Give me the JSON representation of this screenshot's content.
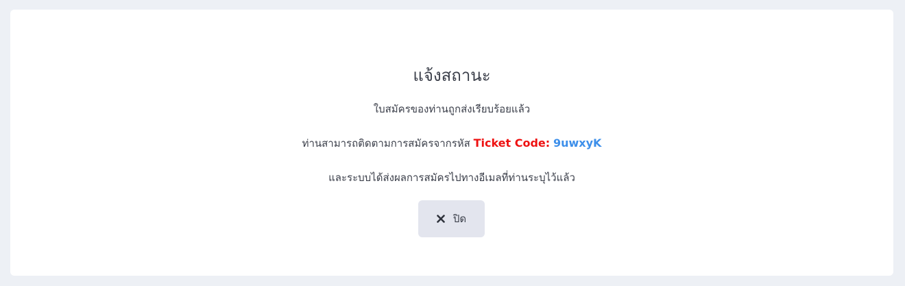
{
  "dialog": {
    "title": "แจ้งสถานะ",
    "message_submitted": "ใบสมัครของท่านถูกส่งเรียบร้อยแล้ว",
    "message_track_prefix": "ท่านสามารถติดตามการสมัครจากรหัส",
    "ticket_label": "Ticket Code:",
    "ticket_code": "9uwxyK",
    "message_email": "และระบบได้ส่งผลการสมัครไปทางอีเมลที่ท่านระบุไว้แล้ว",
    "close_button": {
      "label": "ปิด",
      "icon": "close-icon"
    }
  },
  "colors": {
    "page_background": "#edf0f5",
    "card_background": "#ffffff",
    "ticket_label": "#ee1111",
    "ticket_code": "#3d8fea",
    "button_background": "#e3e5ee",
    "text": "#3b3f4a"
  }
}
